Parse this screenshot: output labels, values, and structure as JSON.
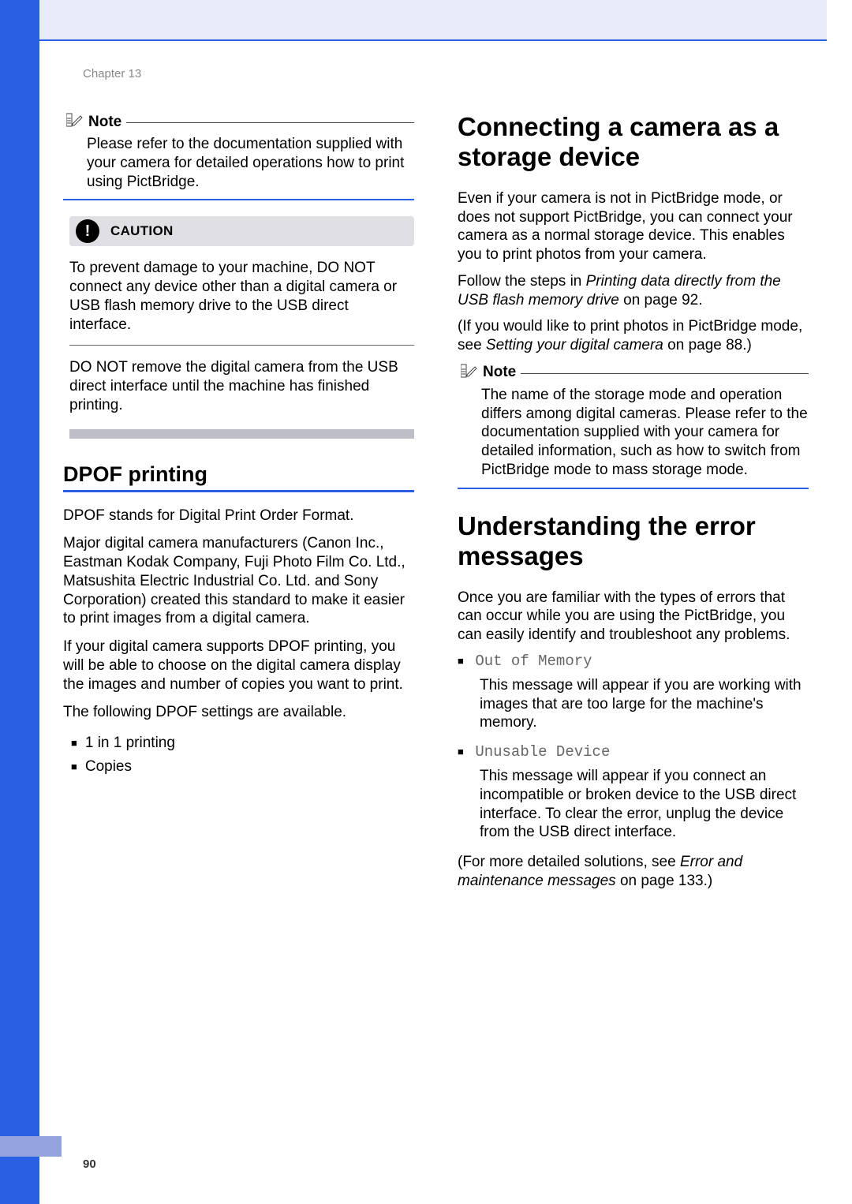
{
  "chapter_label": "Chapter 13",
  "page_number": "90",
  "left": {
    "note1": {
      "label": "Note",
      "body": "Please refer to the documentation supplied with your camera for detailed operations how to print using PictBridge."
    },
    "caution": {
      "label": "CAUTION",
      "p1": "To prevent damage to your machine, DO NOT connect any device other than a digital camera or USB flash memory drive to the USB direct interface.",
      "p2": "DO NOT remove the digital camera from the USB direct interface until the machine has finished printing."
    },
    "dpof": {
      "title": "DPOF printing",
      "p1": "DPOF stands for Digital Print Order Format.",
      "p2": "Major digital camera manufacturers (Canon Inc., Eastman Kodak Company, Fuji Photo Film Co. Ltd., Matsushita Electric Industrial Co. Ltd. and Sony Corporation) created this standard to make it easier to print images from a digital camera.",
      "p3": "If your digital camera supports DPOF printing, you will be able to choose on the digital camera display the images and number of copies you want to print.",
      "p4": "The following DPOF settings are available.",
      "items": [
        "1 in 1 printing",
        "Copies"
      ]
    }
  },
  "right": {
    "connecting": {
      "title": "Connecting a camera as a storage device",
      "p1": "Even if your camera is not in PictBridge mode, or does not support PictBridge, you can connect your camera as a normal storage device. This enables you to print photos from your camera.",
      "p2a": "Follow the steps in ",
      "p2b": "Printing data directly from the USB flash memory drive",
      "p2c": " on page 92.",
      "p3a": "(If you would like to print photos in PictBridge mode, see ",
      "p3b": "Setting your digital camera",
      "p3c": " on page 88.)"
    },
    "note2": {
      "label": "Note",
      "body": "The name of the storage mode and operation differs among digital cameras. Please refer to the documentation supplied with your camera for detailed information, such as how to switch from PictBridge mode to mass storage mode."
    },
    "errors": {
      "title": "Understanding the error messages",
      "intro": "Once you are familiar with the types of errors that can occur while you are using the PictBridge, you can easily identify and troubleshoot any problems.",
      "items": [
        {
          "code": "Out of Memory",
          "desc": "This message will appear if you are working with images that are too large for the machine's memory."
        },
        {
          "code": "Unusable Device",
          "desc": "This message will appear if you connect an incompatible or broken device to the USB direct interface. To clear the error, unplug the device from the USB direct interface."
        }
      ],
      "outro_a": "(For more detailed solutions, see ",
      "outro_b": "Error and maintenance messages",
      "outro_c": " on page 133.)"
    }
  }
}
